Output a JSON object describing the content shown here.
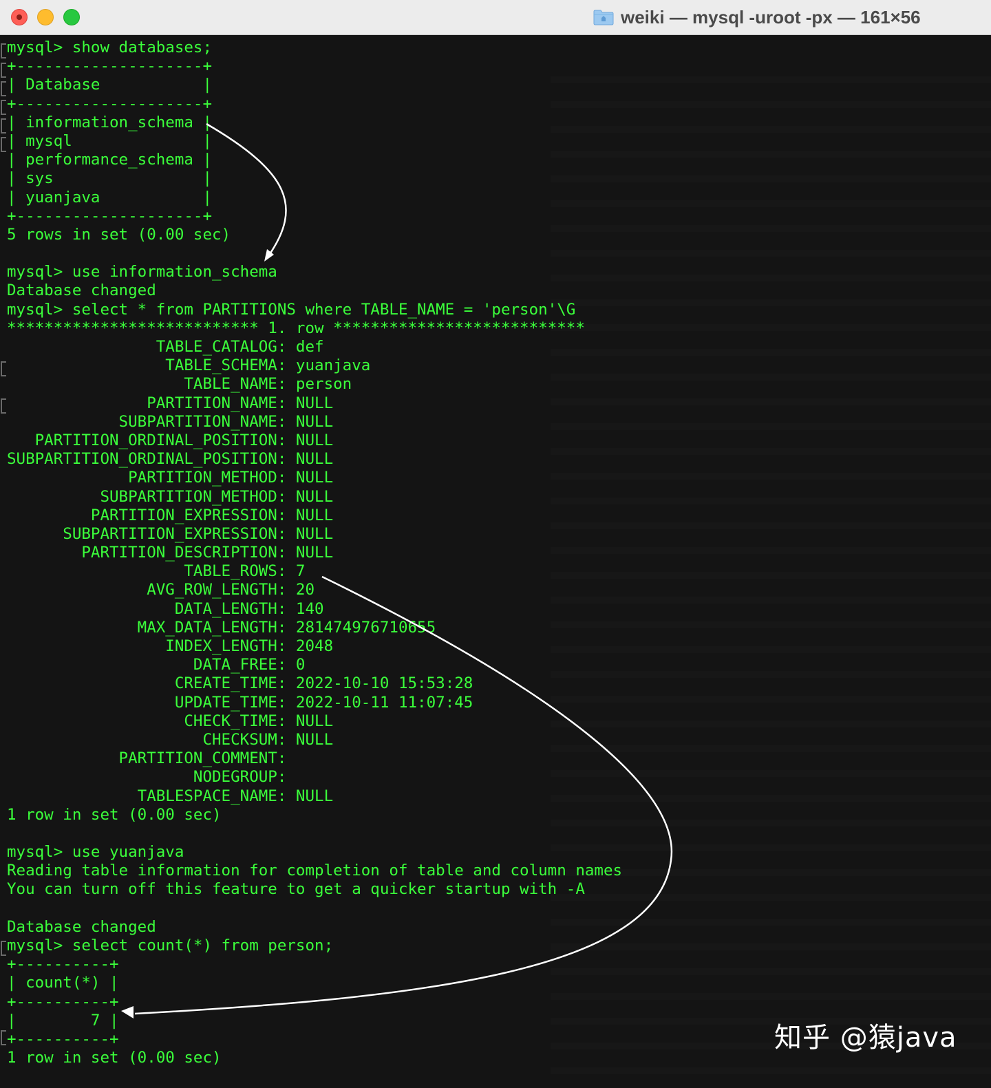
{
  "window": {
    "title": "weiki — mysql -uroot -px — 161×56",
    "buttons": [
      "close",
      "minimize",
      "zoom"
    ],
    "title_icon": "folder-icon"
  },
  "terminal": {
    "text_color": "#3bff3b",
    "background": "#141414",
    "lines": [
      "mysql> show databases;",
      "+--------------------+",
      "| Database           |",
      "+--------------------+",
      "| information_schema |",
      "| mysql              |",
      "| performance_schema |",
      "| sys                |",
      "| yuanjava           |",
      "+--------------------+",
      "5 rows in set (0.00 sec)",
      "",
      "mysql> use information_schema",
      "Database changed",
      "mysql> select * from PARTITIONS where TABLE_NAME = 'person'\\G",
      "*************************** 1. row ***************************",
      "                TABLE_CATALOG: def",
      "                 TABLE_SCHEMA: yuanjava",
      "                   TABLE_NAME: person",
      "               PARTITION_NAME: NULL",
      "            SUBPARTITION_NAME: NULL",
      "   PARTITION_ORDINAL_POSITION: NULL",
      "SUBPARTITION_ORDINAL_POSITION: NULL",
      "             PARTITION_METHOD: NULL",
      "          SUBPARTITION_METHOD: NULL",
      "         PARTITION_EXPRESSION: NULL",
      "      SUBPARTITION_EXPRESSION: NULL",
      "        PARTITION_DESCRIPTION: NULL",
      "                   TABLE_ROWS: 7",
      "               AVG_ROW_LENGTH: 20",
      "                  DATA_LENGTH: 140",
      "              MAX_DATA_LENGTH: 281474976710655",
      "                 INDEX_LENGTH: 2048",
      "                    DATA_FREE: 0",
      "                  CREATE_TIME: 2022-10-10 15:53:28",
      "                  UPDATE_TIME: 2022-10-11 11:07:45",
      "                   CHECK_TIME: NULL",
      "                     CHECKSUM: NULL",
      "            PARTITION_COMMENT: ",
      "                    NODEGROUP: ",
      "              TABLESPACE_NAME: NULL",
      "1 row in set (0.00 sec)",
      "",
      "mysql> use yuanjava",
      "Reading table information for completion of table and column names",
      "You can turn off this feature to get a quicker startup with -A",
      "",
      "Database changed",
      "mysql> select count(*) from person;",
      "+----------+",
      "| count(*) |",
      "+----------+",
      "|        7 |",
      "+----------+",
      "1 row in set (0.00 sec)"
    ]
  },
  "watermark": "知乎 @猿java"
}
